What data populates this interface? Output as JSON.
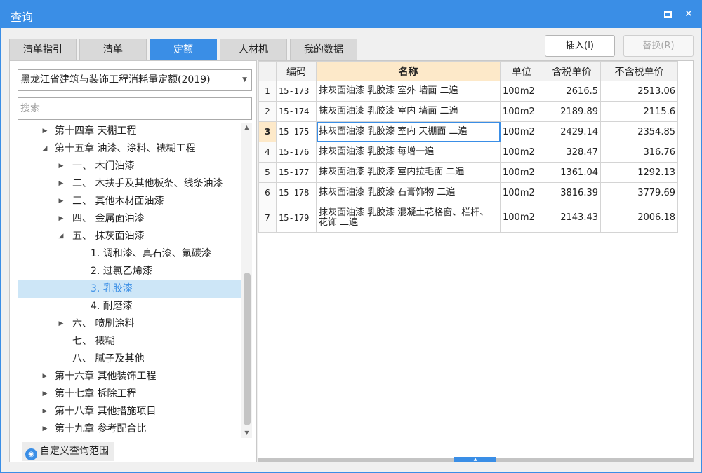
{
  "window": {
    "title": "查询"
  },
  "tabs": [
    "清单指引",
    "清单",
    "定额",
    "人材机",
    "我的数据"
  ],
  "actions": {
    "insert": "插入(I)",
    "replace": "替换(R)"
  },
  "left": {
    "select_value": "黑龙江省建筑与装饰工程消耗量定额(2019)",
    "search_placeholder": "搜索",
    "tree": [
      {
        "label": "第十四章 天棚工程"
      },
      {
        "label": "第十五章 油漆、涂料、裱糊工程"
      },
      {
        "label": "一、 木门油漆"
      },
      {
        "label": "二、 木扶手及其他板条、线条油漆"
      },
      {
        "label": "三、 其他木材面油漆"
      },
      {
        "label": "四、 金属面油漆"
      },
      {
        "label": "五、 抹灰面油漆"
      },
      {
        "label": "1. 调和漆、真石漆、氟碳漆"
      },
      {
        "label": "2. 过氯乙烯漆"
      },
      {
        "label": "3. 乳胶漆"
      },
      {
        "label": "4. 耐磨漆"
      },
      {
        "label": "六、 喷刷涂料"
      },
      {
        "label": "七、 裱糊"
      },
      {
        "label": "八、 腻子及其他"
      },
      {
        "label": "第十六章 其他装饰工程"
      },
      {
        "label": "第十七章 拆除工程"
      },
      {
        "label": "第十八章 其他措施项目"
      },
      {
        "label": "第十九章 参考配合比"
      }
    ],
    "custom_scope": "自定义查询范围"
  },
  "table": {
    "headers": [
      "",
      "编码",
      "名称",
      "单位",
      "含税单价",
      "不含税单价"
    ],
    "rows": [
      {
        "no": "1",
        "code": "15-173",
        "name": "抹灰面油漆 乳胶漆 室外 墙面 二遍",
        "unit": "100m2",
        "tax_price": "2616.5",
        "notax_price": "2513.06"
      },
      {
        "no": "2",
        "code": "15-174",
        "name": "抹灰面油漆 乳胶漆 室内 墙面 二遍",
        "unit": "100m2",
        "tax_price": "2189.89",
        "notax_price": "2115.6"
      },
      {
        "no": "3",
        "code": "15-175",
        "name": "抹灰面油漆 乳胶漆 室内 天棚面 二遍",
        "unit": "100m2",
        "tax_price": "2429.14",
        "notax_price": "2354.85"
      },
      {
        "no": "4",
        "code": "15-176",
        "name": "抹灰面油漆 乳胶漆 每增一遍",
        "unit": "100m2",
        "tax_price": "328.47",
        "notax_price": "316.76"
      },
      {
        "no": "5",
        "code": "15-177",
        "name": "抹灰面油漆 乳胶漆 室内拉毛面 二遍",
        "unit": "100m2",
        "tax_price": "1361.04",
        "notax_price": "1292.13"
      },
      {
        "no": "6",
        "code": "15-178",
        "name": "抹灰面油漆 乳胶漆 石膏饰物 二遍",
        "unit": "100m2",
        "tax_price": "3816.39",
        "notax_price": "3779.69"
      },
      {
        "no": "7",
        "code": "15-179",
        "name": "抹灰面油漆 乳胶漆 混凝土花格窗、栏杆、花饰 二遍",
        "unit": "100m2",
        "tax_price": "2143.43",
        "notax_price": "2006.18"
      }
    ]
  },
  "colors": {
    "accent": "#3a8ee6",
    "header_highlight": "#fde9c9",
    "selection": "#cde6f7"
  }
}
